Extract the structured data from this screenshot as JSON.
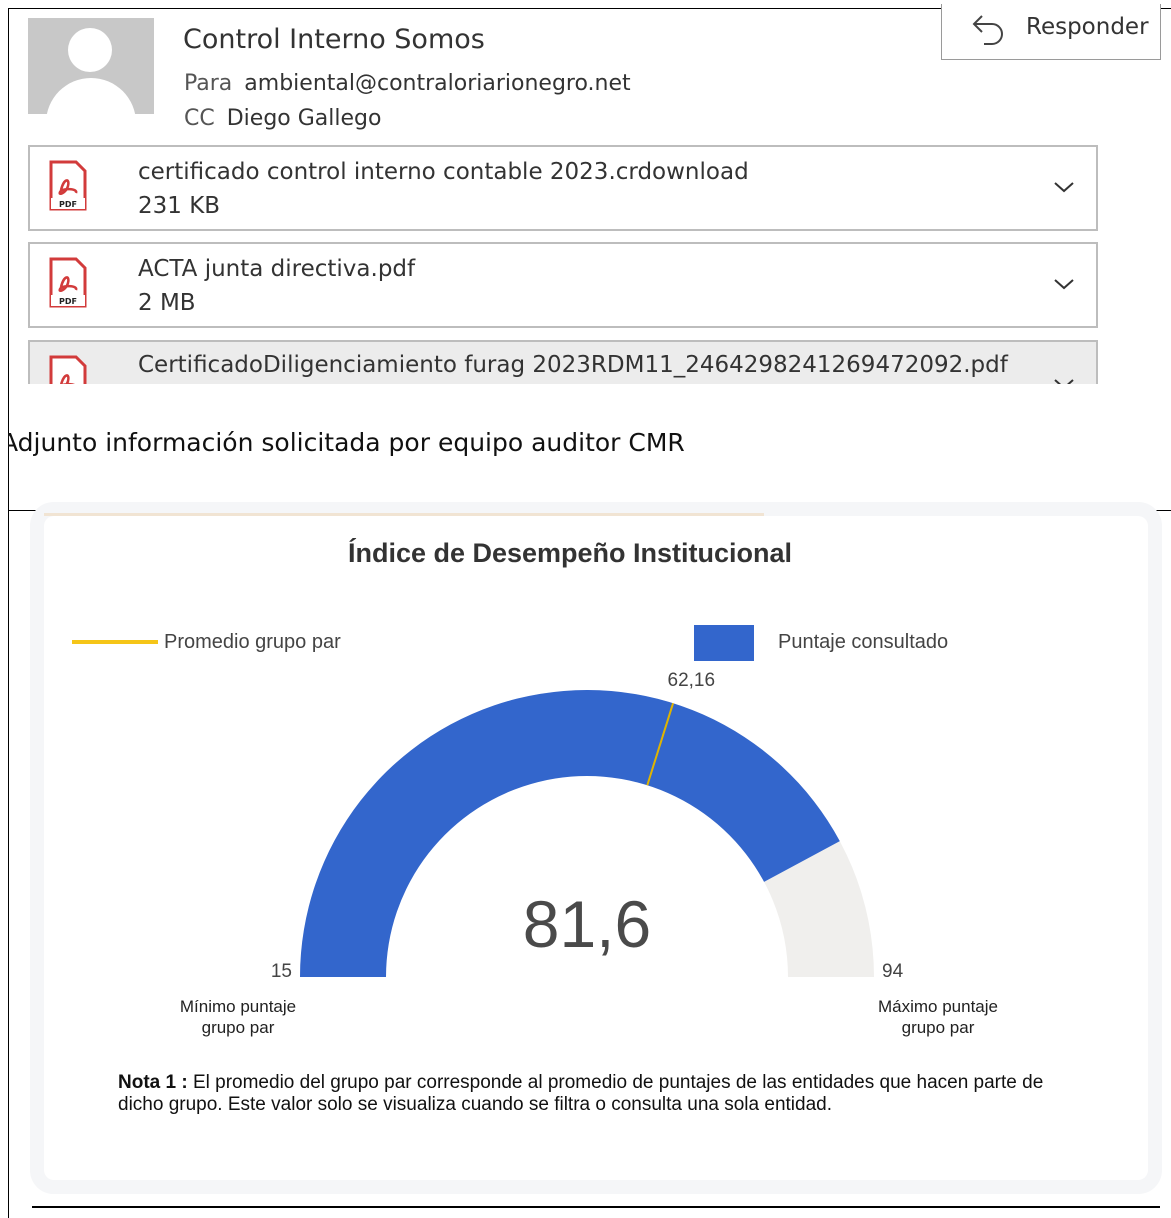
{
  "email": {
    "sender": "Control Interno Somos",
    "to_label": "Para",
    "to_value": "ambiental@contraloriarionegro.net",
    "cc_label": "CC",
    "cc_value": "Diego Gallego",
    "reply_label": "Responder",
    "attachments": [
      {
        "name": "certificado control interno contable 2023.crdownload",
        "size": "231 KB",
        "icon": "pdf-icon"
      },
      {
        "name": "ACTA junta directiva.pdf",
        "size": "2 MB",
        "icon": "pdf-icon"
      },
      {
        "name": "CertificadoDiligenciamiento furag 2023RDM11_2464298241269472092.pdf",
        "size": "",
        "icon": "pdf-icon"
      }
    ],
    "body": "Adjunto información solicitada por equipo auditor CMR"
  },
  "chart_data": {
    "type": "gauge",
    "title": "Índice de Desempeño Institucional",
    "legend": [
      {
        "label": "Promedio grupo par",
        "color": "#f5c518",
        "kind": "line"
      },
      {
        "label": "Puntaje consultado",
        "color": "#3366cc",
        "kind": "swatch"
      }
    ],
    "min": 15,
    "max": 94,
    "min_text": "15",
    "max_text": "94",
    "value": 81.6,
    "value_text": "81,6",
    "peer_average": 62.16,
    "peer_average_text": "62,16",
    "min_caption_line1": "Mínimo puntaje",
    "min_caption_line2": "grupo par",
    "max_caption_line1": "Máximo puntaje",
    "max_caption_line2": "grupo par",
    "fill_color": "#3366cc",
    "track_color": "#f0efed",
    "marker_color": "#e0b400"
  },
  "note": {
    "label": "Nota 1 :",
    "text": "El promedio del grupo par corresponde al promedio de puntajes de las entidades que hacen parte de dicho grupo.  Este valor solo se visualiza cuando se filtra o consulta una sola entidad."
  }
}
